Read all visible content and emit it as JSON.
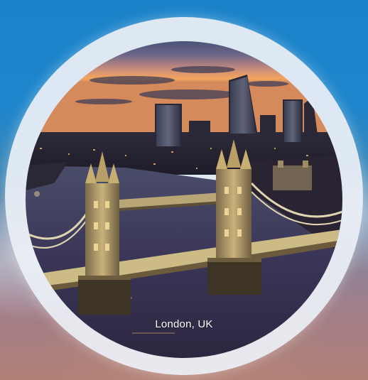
{
  "caption": {
    "location": "London, UK"
  },
  "colors": {
    "sky_top": "#1a82c8",
    "ring": "#eef1f6",
    "caption_text": "#ffffff"
  },
  "image": {
    "subject_icon": "tower-bridge-photo"
  }
}
